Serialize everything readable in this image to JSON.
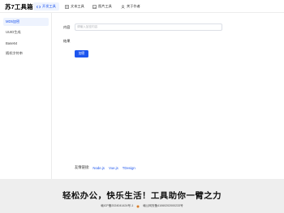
{
  "header": {
    "logo": "苏7工具箱",
    "nav": [
      {
        "label": "开发工具",
        "icon": "code-icon",
        "active": true
      },
      {
        "label": "文本工具",
        "icon": "text-icon",
        "active": false
      },
      {
        "label": "图片工具",
        "icon": "image-icon",
        "active": false
      },
      {
        "label": "关于作者",
        "icon": "user-icon",
        "active": false
      }
    ]
  },
  "sidebar": {
    "items": [
      {
        "label": "MD5加密",
        "active": true
      },
      {
        "label": "UUID生成",
        "active": false
      },
      {
        "label": "Base64",
        "active": false
      },
      {
        "label": "随机字符串",
        "active": false
      }
    ]
  },
  "form": {
    "content_label": "内容",
    "input_placeholder": "请输入加密内容",
    "result_label": "结果",
    "submit_label": "加密"
  },
  "links": {
    "label": "友情链接:",
    "items": [
      "Node.js",
      "Vue.js",
      "TDesign"
    ]
  },
  "footer": {
    "slogan": "轻松办公，快乐生活！工具助你一臂之力",
    "icp": "赣ICP备2024041424号-1",
    "police": "赣公网安备41060202000233号"
  },
  "colors": {
    "accent": "#1d55ee",
    "active_bg": "#eef3fe",
    "footer_bg": "#eeeeee"
  }
}
